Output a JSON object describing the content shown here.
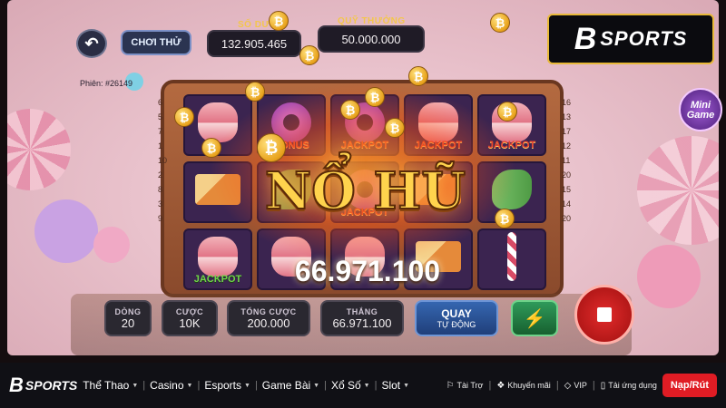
{
  "header": {
    "trial_label": "CHƠI THỬ",
    "balance_label": "SỐ DƯ",
    "balance_value": "132.905.465",
    "jackpot_label": "QUỸ THƯỞNG",
    "jackpot_value": "50.000.000",
    "session": "Phiên: #26149"
  },
  "reels": {
    "left_lines": [
      "6",
      "5",
      "7",
      "1",
      "10",
      "2",
      "8",
      "3",
      "9"
    ],
    "right_lines": [
      "16",
      "13",
      "17",
      "12",
      "11",
      "20",
      "15",
      "14",
      "20"
    ],
    "cells": [
      {
        "symbol": "macaron",
        "tag": ""
      },
      {
        "symbol": "donut",
        "tag": "BONUS"
      },
      {
        "symbol": "donut",
        "tag": "JACKPOT"
      },
      {
        "symbol": "macaron",
        "tag": "JACKPOT"
      },
      {
        "symbol": "macaron",
        "tag": "JACKPOT"
      },
      {
        "symbol": "cake",
        "tag": ""
      },
      {
        "symbol": "candy",
        "tag": ""
      },
      {
        "symbol": "donut",
        "tag": "JACKPOT"
      },
      {
        "symbol": "cake",
        "tag": ""
      },
      {
        "symbol": "candy",
        "tag": ""
      },
      {
        "symbol": "macaron",
        "tag": "JACKPOT"
      },
      {
        "symbol": "macaron",
        "tag": ""
      },
      {
        "symbol": "macaron",
        "tag": ""
      },
      {
        "symbol": "cake",
        "tag": ""
      },
      {
        "symbol": "lollipop",
        "tag": ""
      }
    ]
  },
  "win": {
    "title": "NỔ HŨ",
    "amount": "66.971.100"
  },
  "controls": {
    "lines_label": "DÒNG",
    "lines_value": "20",
    "bet_label": "CƯỢC",
    "bet_value": "10K",
    "total_bet_label": "TỔNG CƯỢC",
    "total_bet_value": "200.000",
    "win_label": "THẮNG",
    "win_value": "66.971.100",
    "auto_label_1": "QUAY",
    "auto_label_2": "TỰ ĐỘNG"
  },
  "brand": {
    "logo_b": "B",
    "logo_text": "SPORTS"
  },
  "minigame_label": "Mini Game",
  "bottom_nav": {
    "logo_b": "B",
    "logo_text": "SPORTS",
    "items": [
      "Thể Thao",
      "Casino",
      "Esports",
      "Game Bài",
      "Xổ Số",
      "Slot"
    ],
    "right_items": [
      "Tài Trợ",
      "Khuyến mãi",
      "VIP",
      "Tải ứng dụng"
    ],
    "deposit_label": "Nạp/Rút"
  },
  "colors": {
    "accent_gold": "#e8b93a",
    "deposit_red": "#e01c24"
  }
}
